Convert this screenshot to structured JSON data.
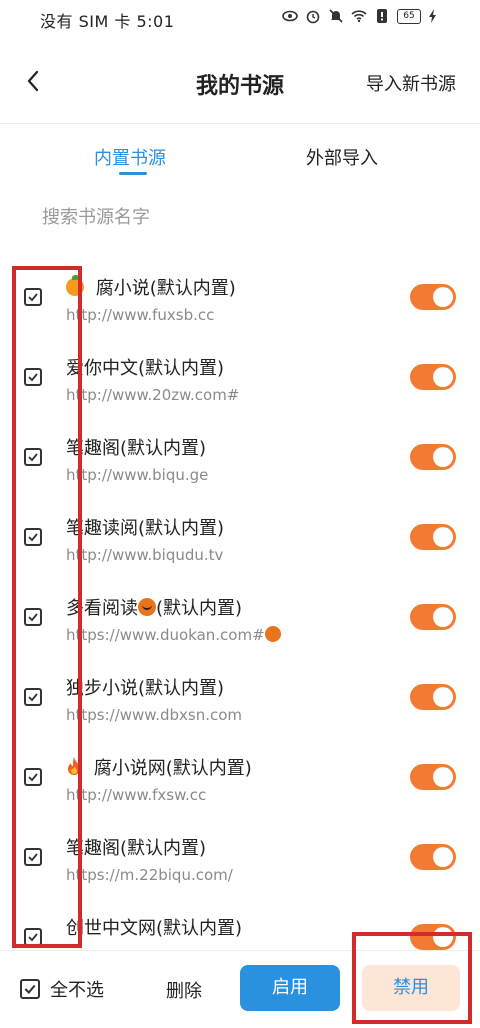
{
  "status_bar": {
    "carrier_time": "没有 SIM 卡 5:01",
    "battery": "65",
    "icons": [
      "eye-icon",
      "alarm-icon",
      "mute-icon",
      "wifi-icon",
      "notification-icon",
      "battery-icon",
      "charging-icon"
    ]
  },
  "header": {
    "back_icon": "chevron-left-icon",
    "title": "我的书源",
    "import_label": "导入新书源"
  },
  "tabs": [
    {
      "label": "内置书源",
      "active": true
    },
    {
      "label": "外部导入",
      "active": false
    }
  ],
  "search": {
    "placeholder": "搜索书源名字",
    "value": ""
  },
  "sources": [
    {
      "title": "腐小说(默认内置)",
      "prefix_emoji": "tangerine-icon",
      "url": "http://www.fuxsb.cc",
      "checked": true,
      "enabled": true
    },
    {
      "title": "爱你中文(默认内置)",
      "url": "http://www.20zw.com#",
      "checked": true,
      "enabled": true
    },
    {
      "title": "笔趣阁(默认内置)",
      "url": "http://www.biqu.ge",
      "checked": true,
      "enabled": true
    },
    {
      "title": "笔趣读阅(默认内置)",
      "url": "http://www.biqudu.tv",
      "checked": true,
      "enabled": true
    },
    {
      "title_before": "多看阅读",
      "title_after": "(默认内置)",
      "mid_emoji": "pumpkin-icon",
      "url": "https://www.duokan.com#",
      "url_emoji": "pumpkin-icon",
      "checked": true,
      "enabled": true
    },
    {
      "title": "独步小说(默认内置)",
      "url": "https://www.dbxsn.com",
      "checked": true,
      "enabled": true
    },
    {
      "title": "腐小说网(默认内置)",
      "prefix_emoji": "fire-icon",
      "url": "http://www.fxsw.cc",
      "checked": true,
      "enabled": true
    },
    {
      "title": "笔趣阁(默认内置)",
      "url": "https://m.22biqu.com/",
      "checked": true,
      "enabled": true
    },
    {
      "title": "创世中文网(默认内置)",
      "url": "",
      "checked": true,
      "enabled": true
    }
  ],
  "bottom_bar": {
    "select_all_label": "全不选",
    "delete_label": "删除",
    "enable_label": "启用",
    "disable_label": "禁用"
  },
  "colors": {
    "accent_blue": "#2a90e0",
    "toggle_orange": "#f27a32",
    "disable_bg": "#fde6d6",
    "highlight_red": "#d12b2b"
  }
}
